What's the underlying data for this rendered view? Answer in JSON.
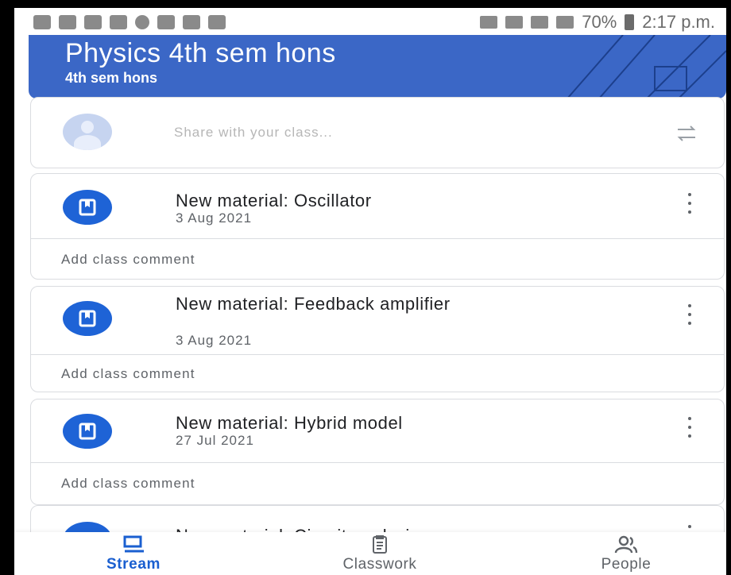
{
  "status_bar": {
    "battery": "70%",
    "time": "2:17 p.m."
  },
  "class": {
    "title": "Physics 4th sem hons",
    "section": "4th sem hons",
    "banner_color": "#3b67c6"
  },
  "share": {
    "placeholder": "Share with your class..."
  },
  "posts": [
    {
      "title": "New material: Oscillator",
      "date": "3 Aug 2021",
      "comment": "Add class comment"
    },
    {
      "title": "New material: Feedback amplifier",
      "date": "3 Aug 2021",
      "comment": "Add class comment"
    },
    {
      "title": "New material: Hybrid model",
      "date": "27 Jul 2021",
      "comment": "Add class comment"
    },
    {
      "title": "New material: Circuit analysis"
    }
  ],
  "nav": {
    "stream": "Stream",
    "classwork": "Classwork",
    "people": "People",
    "active_color": "#1a5fd0"
  },
  "accent": "#1e63d6"
}
